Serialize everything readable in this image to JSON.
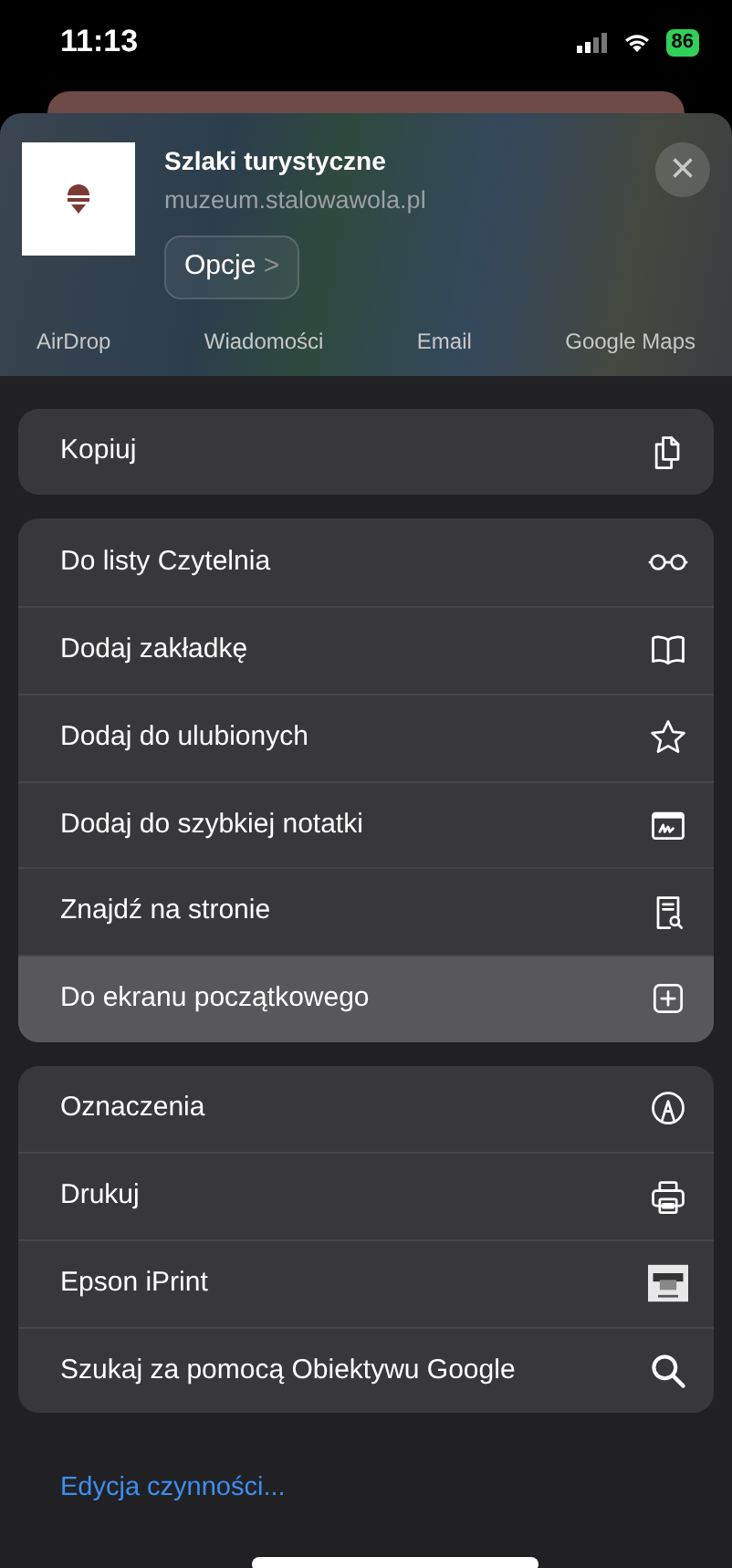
{
  "status_bar": {
    "time": "11:13",
    "battery": "86"
  },
  "share_header": {
    "title": "Szlaki turystyczne",
    "url": "muzeum.stalowawola.pl",
    "options_button": "Opcje",
    "options_chevron": ">",
    "close": "×"
  },
  "apps": [
    {
      "label": "AirDrop"
    },
    {
      "label": "Wiadomości"
    },
    {
      "label": "Email"
    },
    {
      "label": "Google Maps"
    }
  ],
  "action_groups": [
    [
      {
        "label": "Kopiuj",
        "kind": "copy",
        "highlighted": false
      }
    ],
    [
      {
        "label": "Do listy Czytelnia",
        "kind": "glasses",
        "highlighted": false
      },
      {
        "label": "Dodaj zakładkę",
        "kind": "book",
        "highlighted": false
      },
      {
        "label": "Dodaj do ulubionych",
        "kind": "star",
        "highlighted": false
      },
      {
        "label": "Dodaj do szybkiej notatki",
        "kind": "note",
        "highlighted": false
      },
      {
        "label": "Znajdź na stronie",
        "kind": "find",
        "highlighted": false
      },
      {
        "label": "Do ekranu początkowego",
        "kind": "add",
        "highlighted": true
      }
    ],
    [
      {
        "label": "Oznaczenia",
        "kind": "markup",
        "highlighted": false
      },
      {
        "label": "Drukuj",
        "kind": "print",
        "highlighted": false
      },
      {
        "label": "Epson iPrint",
        "kind": "epson",
        "highlighted": false
      },
      {
        "label": "Szukaj za pomocą Obiektywu Google",
        "kind": "search",
        "highlighted": false
      }
    ]
  ],
  "edit_actions_link": "Edycja czynności..."
}
